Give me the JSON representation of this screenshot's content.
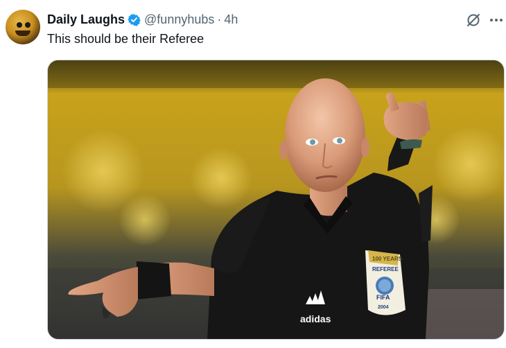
{
  "tweet": {
    "author_name": "Daily Laughs",
    "handle": "@funnyhubs",
    "separator": "·",
    "time": "4h",
    "text": "This should be their Referee"
  },
  "icons": {
    "verified": "verified-badge-icon",
    "grok": "grok-icon",
    "more": "more-options-icon"
  },
  "media": {
    "badge_line1": "100 YEARS",
    "badge_line2": "REFEREE",
    "badge_line3": "FIFA",
    "badge_line4": "2004",
    "kit_brand": "adidas"
  },
  "colors": {
    "verified_blue": "#1d9bf0",
    "text_primary": "#0f1419",
    "text_secondary": "#536471"
  }
}
